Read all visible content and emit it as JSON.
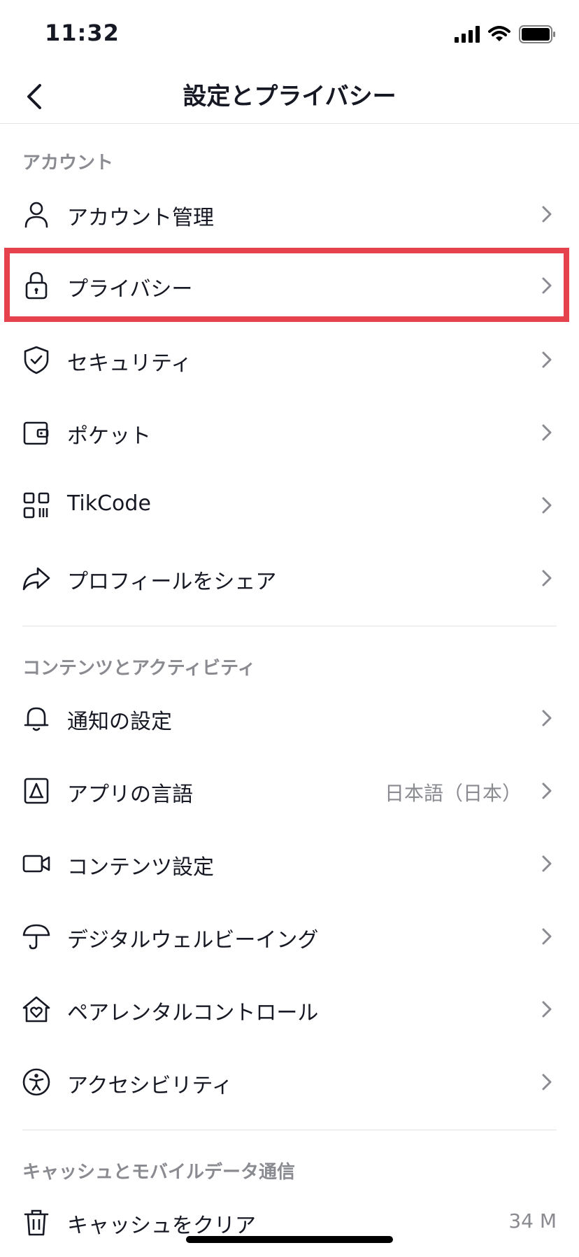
{
  "status": {
    "time": "11:32"
  },
  "header": {
    "title": "設定とプライバシー"
  },
  "sections": [
    {
      "title": "アカウント",
      "items": [
        {
          "label": "アカウント管理",
          "icon": "person-icon"
        },
        {
          "label": "プライバシー",
          "icon": "lock-icon"
        },
        {
          "label": "セキュリティ",
          "icon": "shield-icon"
        },
        {
          "label": "ポケット",
          "icon": "wallet-icon"
        },
        {
          "label": "TikCode",
          "icon": "qr-code-icon"
        },
        {
          "label": "プロフィールをシェア",
          "icon": "share-arrow-icon"
        }
      ]
    },
    {
      "title": "コンテンツとアクティビティ",
      "items": [
        {
          "label": "通知の設定",
          "icon": "bell-icon"
        },
        {
          "label": "アプリの言語",
          "value": "日本語（日本）",
          "icon": "language-icon"
        },
        {
          "label": "コンテンツ設定",
          "icon": "video-camera-icon"
        },
        {
          "label": "デジタルウェルビーイング",
          "icon": "umbrella-icon"
        },
        {
          "label": "ペアレンタルコントロール",
          "icon": "house-heart-icon"
        },
        {
          "label": "アクセシビリティ",
          "icon": "accessibility-icon"
        }
      ]
    },
    {
      "title": "キャッシュとモバイルデータ通信",
      "items": [
        {
          "label": "キャッシュをクリア",
          "value": "34 M",
          "icon": "trash-icon"
        }
      ]
    }
  ],
  "colors": {
    "highlight": "#e5424e",
    "text": "#161823",
    "secondary": "#8a8b91",
    "divider": "#e3e3e4"
  }
}
